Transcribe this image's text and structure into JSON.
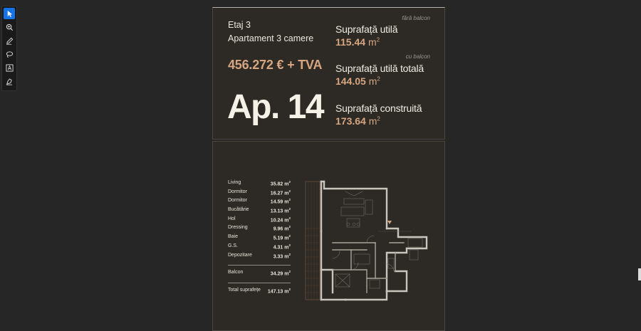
{
  "toolbar": {
    "tools": [
      {
        "icon": "pointer-icon",
        "active": true
      },
      {
        "icon": "zoom-icon",
        "active": false
      },
      {
        "icon": "pen-icon",
        "active": false
      },
      {
        "icon": "lasso-icon",
        "active": false
      },
      {
        "icon": "text-box-icon",
        "active": false
      },
      {
        "icon": "stamp-icon",
        "active": false
      }
    ]
  },
  "header": {
    "floor": "Etaj 3",
    "apartment_type": "Apartament 3 camere",
    "price": "456.272 € + TVA",
    "apartment_number": "Ap. 14",
    "areas": [
      {
        "note": "fără balcon",
        "label": "Suprafață utilă",
        "value": "115.44",
        "unit": "m",
        "exp": "2"
      },
      {
        "note": "cu balcon",
        "label": "Suprafață utilă totală",
        "value": "144.05",
        "unit": "m",
        "exp": "2"
      },
      {
        "note": "",
        "label": "Suprafață construită",
        "value": "173.64",
        "unit": "m",
        "exp": "2"
      }
    ]
  },
  "rooms": [
    {
      "name": "Living",
      "area": "35.82 m",
      "exp": "2"
    },
    {
      "name": "Dormitor",
      "area": "16.27 m",
      "exp": "2"
    },
    {
      "name": "Dormitor",
      "area": "14.59 m",
      "exp": "2"
    },
    {
      "name": "Bucătărie",
      "area": "13.13 m",
      "exp": "2"
    },
    {
      "name": "Hol",
      "area": "10.24 m",
      "exp": "2"
    },
    {
      "name": "Dressing",
      "area": "9.96 m",
      "exp": "2"
    },
    {
      "name": "Baie",
      "area": "5.19 m",
      "exp": "2"
    },
    {
      "name": "G.S.",
      "area": "4.31 m",
      "exp": "2"
    },
    {
      "name": "Depozitare",
      "area": "3.33 m",
      "exp": "2"
    }
  ],
  "totals": [
    {
      "name": "Balcon",
      "area": "34.29 m",
      "exp": "2"
    },
    {
      "name": "Total suprafețe",
      "area": "147.13 m",
      "exp": "2"
    }
  ],
  "colors": {
    "accent": "#d7a680",
    "background": "#262626",
    "card": "#2d2a26",
    "active_tool": "#1473e6"
  }
}
